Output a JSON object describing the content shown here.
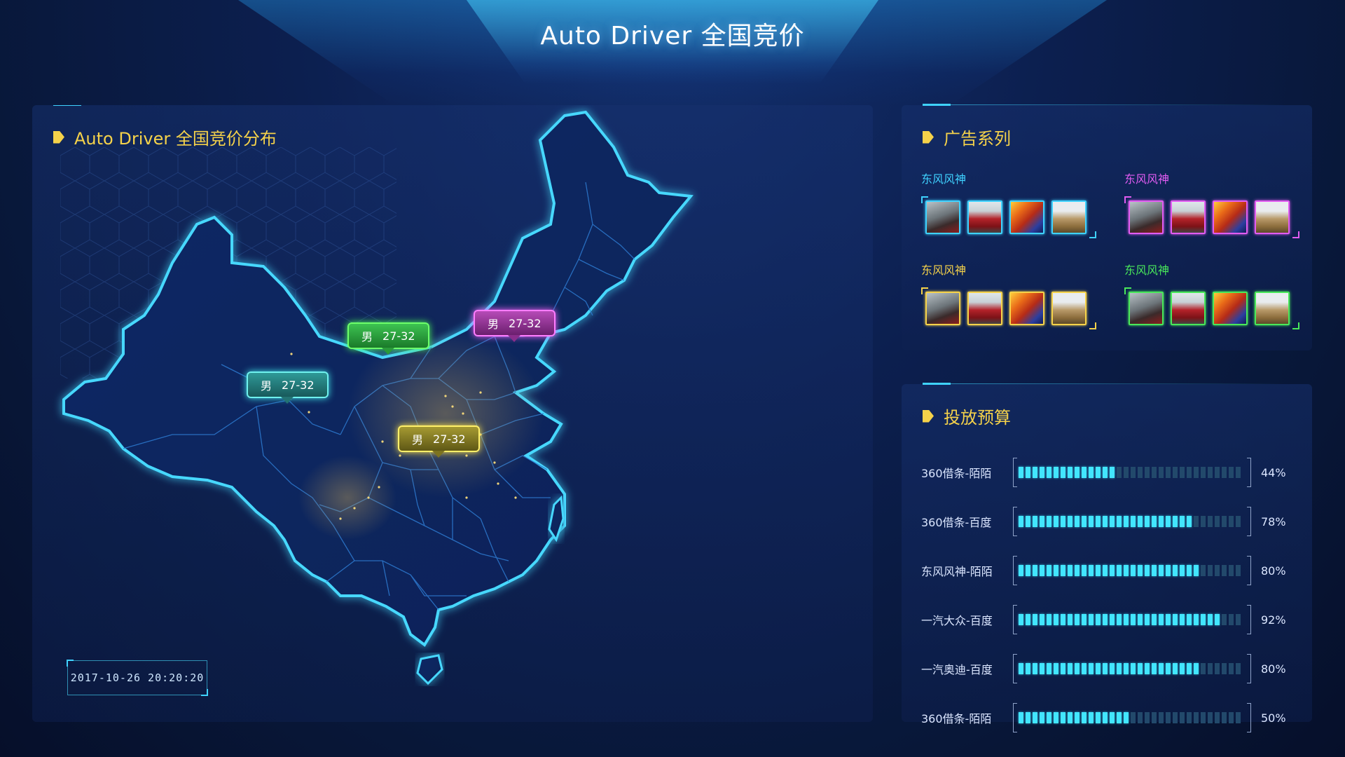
{
  "header": {
    "title": "Auto Driver 全国竞价"
  },
  "map_panel": {
    "title": "Auto Driver 全国竞价分布",
    "tags": [
      {
        "gender": "男",
        "age": "27-32",
        "color": "green"
      },
      {
        "gender": "男",
        "age": "27-32",
        "color": "purple"
      },
      {
        "gender": "男",
        "age": "27-32",
        "color": "teal"
      },
      {
        "gender": "男",
        "age": "27-32",
        "color": "gold"
      }
    ],
    "timestamp": "2017-10-26  20:20:20"
  },
  "ads_panel": {
    "title": "广告系列",
    "groups": [
      {
        "label": "东风风神",
        "color": "#3fd2ff"
      },
      {
        "label": "东风风神",
        "color": "#e25cf2"
      },
      {
        "label": "东风风神",
        "color": "#f5d24a"
      },
      {
        "label": "东风风神",
        "color": "#49e85a"
      }
    ]
  },
  "budget_panel": {
    "title": "投放预算",
    "rows": [
      {
        "label": "360借条-陌陌",
        "percent_text": "44%",
        "value": 0.44
      },
      {
        "label": "360借条-百度",
        "percent_text": "78%",
        "value": 0.78
      },
      {
        "label": "东风风神-陌陌",
        "percent_text": "80%",
        "value": 0.8
      },
      {
        "label": "一汽大众-百度",
        "percent_text": "92%",
        "value": 0.92
      },
      {
        "label": "一汽奥迪-百度",
        "percent_text": "80%",
        "value": 0.8
      },
      {
        "label": "360借条-陌陌",
        "percent_text": "50%",
        "value": 0.5
      }
    ]
  },
  "colors": {
    "accent": "#3fd2ff",
    "title_yellow": "#f5d24a",
    "bar_on": "#42e6ff",
    "bar_off": "#22496b"
  }
}
